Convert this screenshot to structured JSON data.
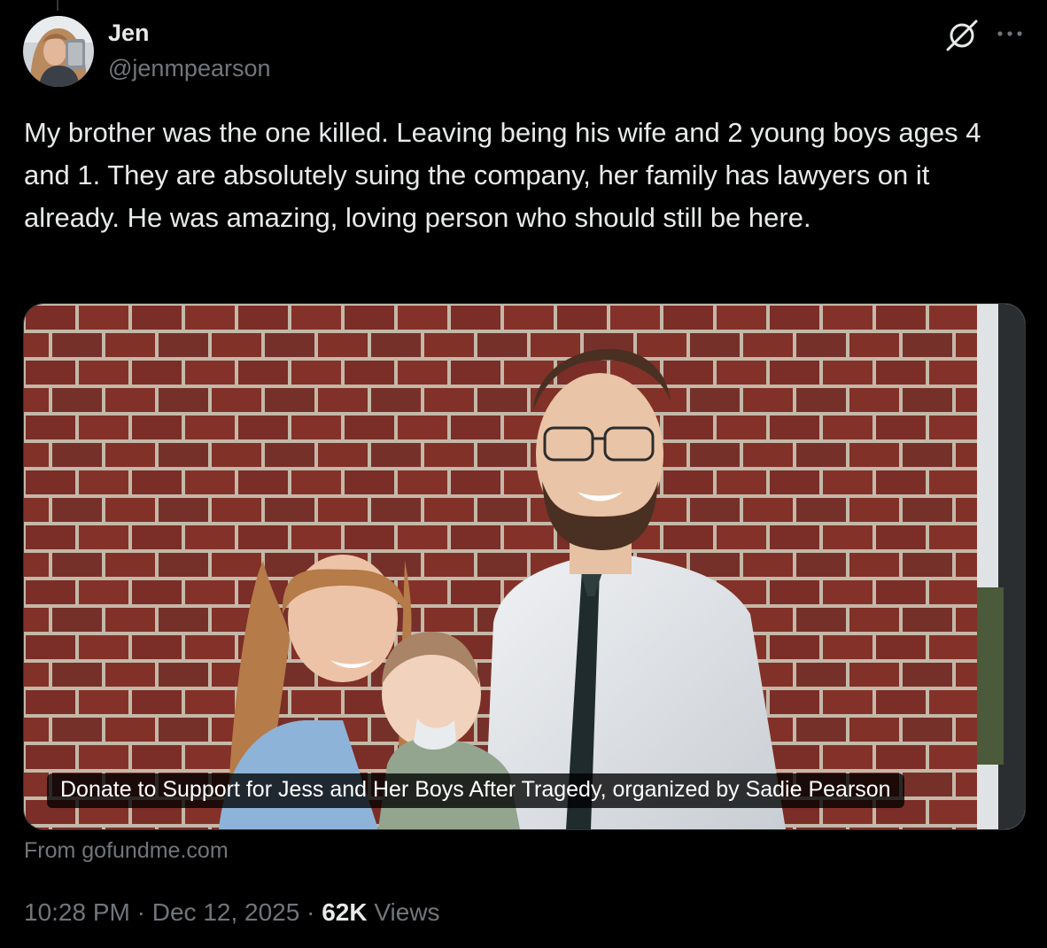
{
  "author": {
    "name": "Jen",
    "handle": "@jenmpearson"
  },
  "icons": {
    "grok": "grok-icon",
    "more": "more-options-icon"
  },
  "tweet": {
    "text": "My brother was the one killed. Leaving being his wife and 2 young boys ages 4 and 1. They are absolutely suing the company, her family has lawyers on it already. He was amazing, loving person who should still be here."
  },
  "card": {
    "caption": "Donate to Support for Jess and Her Boys After Tragedy, organized by Sadie Pearson",
    "source": "From gofundme.com"
  },
  "meta": {
    "time": "10:28 PM",
    "separator": "·",
    "date": "Dec 12, 2025",
    "views_count": "62K",
    "views_label": "Views"
  },
  "colors": {
    "background": "#000000",
    "text_primary": "#e7e9ea",
    "text_secondary": "#71767b",
    "border": "#2f3336"
  }
}
